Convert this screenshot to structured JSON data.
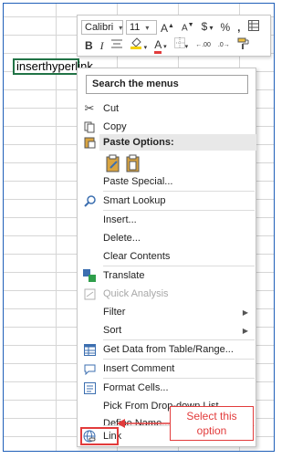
{
  "cell": {
    "text": "inserthyperlink"
  },
  "mini_toolbar": {
    "font_name": "Calibri",
    "font_size": "11",
    "bold": "B",
    "italic": "I",
    "grow_font": "A",
    "shrink_font": "A",
    "currency": "$",
    "percent": "%",
    "comma": ",",
    "font_color_letter": "A",
    "inc_decimal": ".00",
    "dec_decimal": ".0"
  },
  "menu": {
    "search_label": "Search the menus",
    "items": {
      "cut": "Cut",
      "copy": "Copy",
      "paste_options": "Paste Options:",
      "paste_special": "Paste Special...",
      "smart_lookup": "Smart Lookup",
      "insert": "Insert...",
      "delete": "Delete...",
      "clear_contents": "Clear Contents",
      "translate": "Translate",
      "quick_analysis": "Quick Analysis",
      "filter": "Filter",
      "sort": "Sort",
      "get_data": "Get Data from Table/Range...",
      "insert_comment": "Insert Comment",
      "format_cells": "Format Cells...",
      "pick_dropdown": "Pick From Drop-down List...",
      "define_name": "Define Name...",
      "link": "Link"
    }
  },
  "callout": {
    "line1": "Select this",
    "line2": "option"
  },
  "colors": {
    "accent_red": "#e23b3b",
    "cell_border": "#217346",
    "icon_blue": "#3c6fb0"
  }
}
